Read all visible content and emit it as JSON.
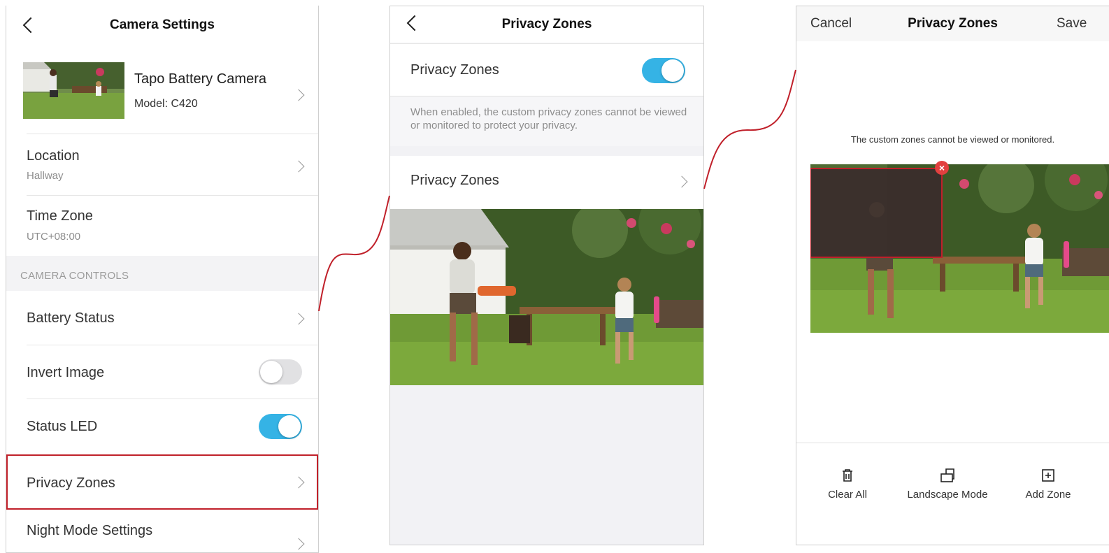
{
  "panel1": {
    "title": "Camera Settings",
    "device": {
      "name": "Tapo Battery Camera",
      "model": "Model: C420"
    },
    "location": {
      "label": "Location",
      "value": "Hallway"
    },
    "timezone": {
      "label": "Time Zone",
      "value": "UTC+08:00"
    },
    "section_header": "CAMERA CONTROLS",
    "battery_status": "Battery Status",
    "invert_image": {
      "label": "Invert Image",
      "on": false
    },
    "status_led": {
      "label": "Status LED",
      "on": true
    },
    "privacy_zones": "Privacy Zones",
    "night_mode": "Night Mode Settings"
  },
  "panel2": {
    "title": "Privacy Zones",
    "toggle_label": "Privacy Zones",
    "toggle_on": true,
    "description": "When enabled, the custom privacy zones cannot be viewed or monitored to protect your privacy.",
    "nav_label": "Privacy Zones"
  },
  "panel3": {
    "cancel": "Cancel",
    "title": "Privacy Zones",
    "save": "Save",
    "hint": "The custom zones cannot be viewed or monitored.",
    "tools": {
      "clear_all": "Clear All",
      "landscape_mode": "Landscape Mode",
      "add_zone": "Add Zone"
    }
  },
  "colors": {
    "accent": "#35b3e5",
    "highlight": "#c0202a"
  }
}
